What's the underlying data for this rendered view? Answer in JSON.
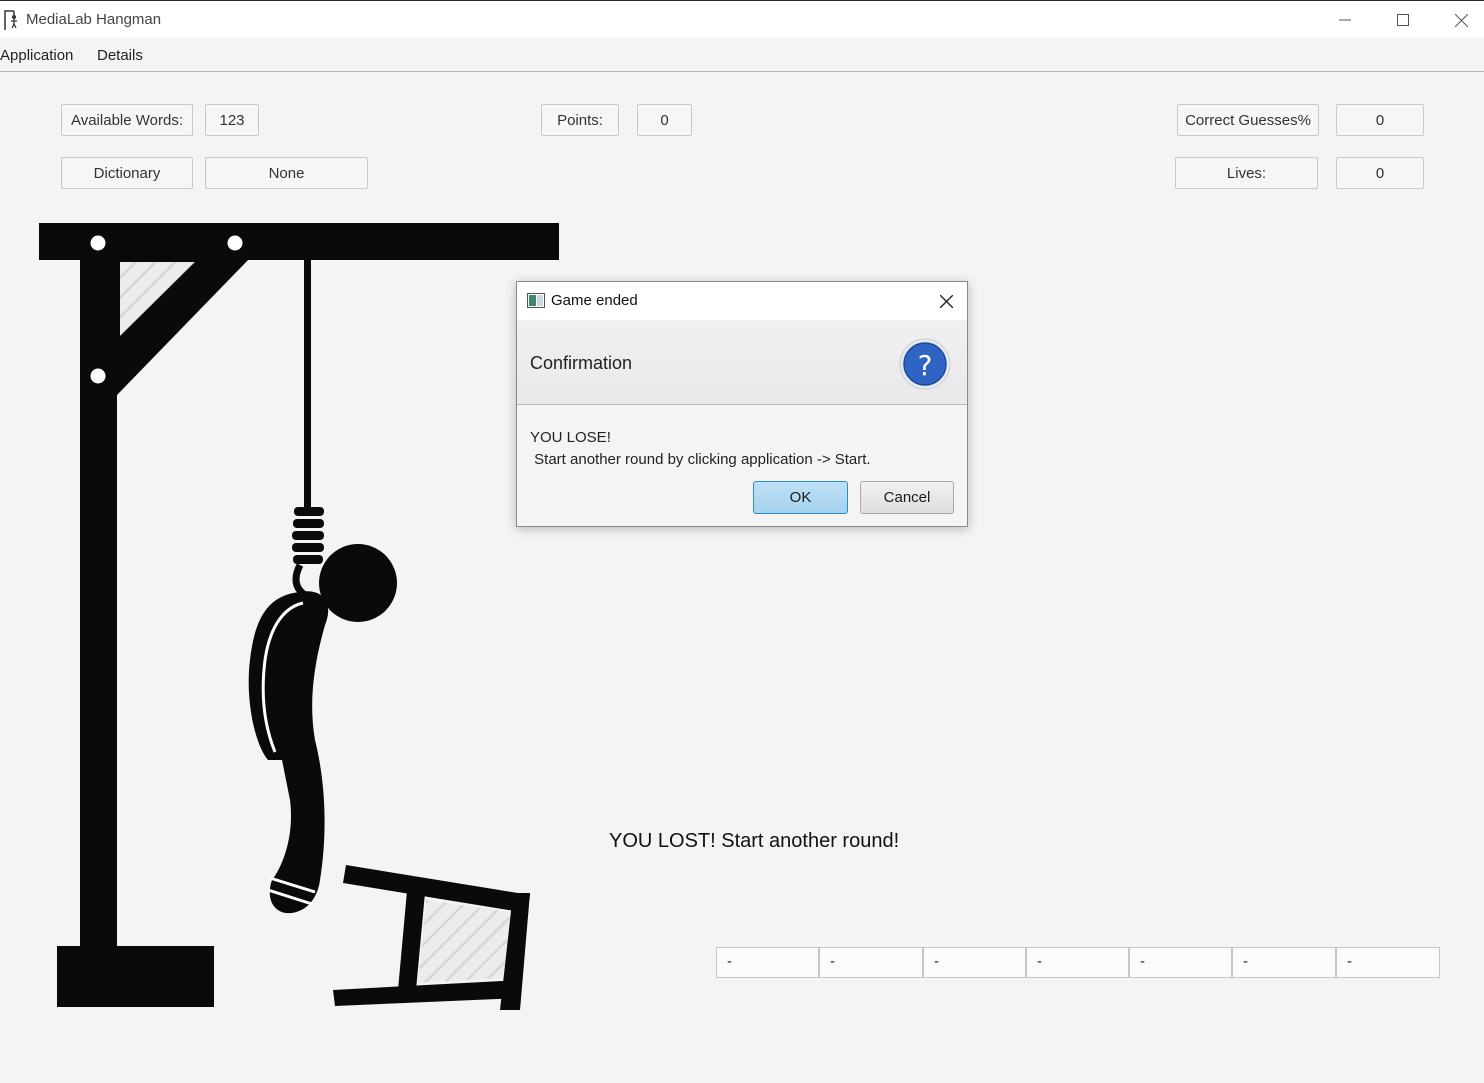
{
  "window": {
    "title": "MediaLab Hangman"
  },
  "menu": {
    "items": [
      "Application",
      "Details"
    ]
  },
  "stats": {
    "available_words_label": "Available Words:",
    "available_words_value": "123",
    "points_label": "Points:",
    "points_value": "0",
    "correct_guesses_label": "Correct Guesses%",
    "correct_guesses_value": "0",
    "dictionary_label": "Dictionary",
    "dictionary_value": "None",
    "lives_label": "Lives:",
    "lives_value": "0"
  },
  "status_message": "YOU LOST! Start another round!",
  "word_slots": [
    "-",
    "-",
    "-",
    "-",
    "-",
    "-",
    "-"
  ],
  "dialog": {
    "title": "Game ended",
    "header": "Confirmation",
    "content_line1": "YOU LOSE!",
    "content_line2": " Start another round by clicking application -> Start.",
    "ok_label": "OK",
    "cancel_label": "Cancel",
    "icon": "question-icon"
  },
  "colors": {
    "dialog_icon": "#2f63c4",
    "ok_button": "#a4d2ee",
    "ink": "#0a0a0a"
  }
}
